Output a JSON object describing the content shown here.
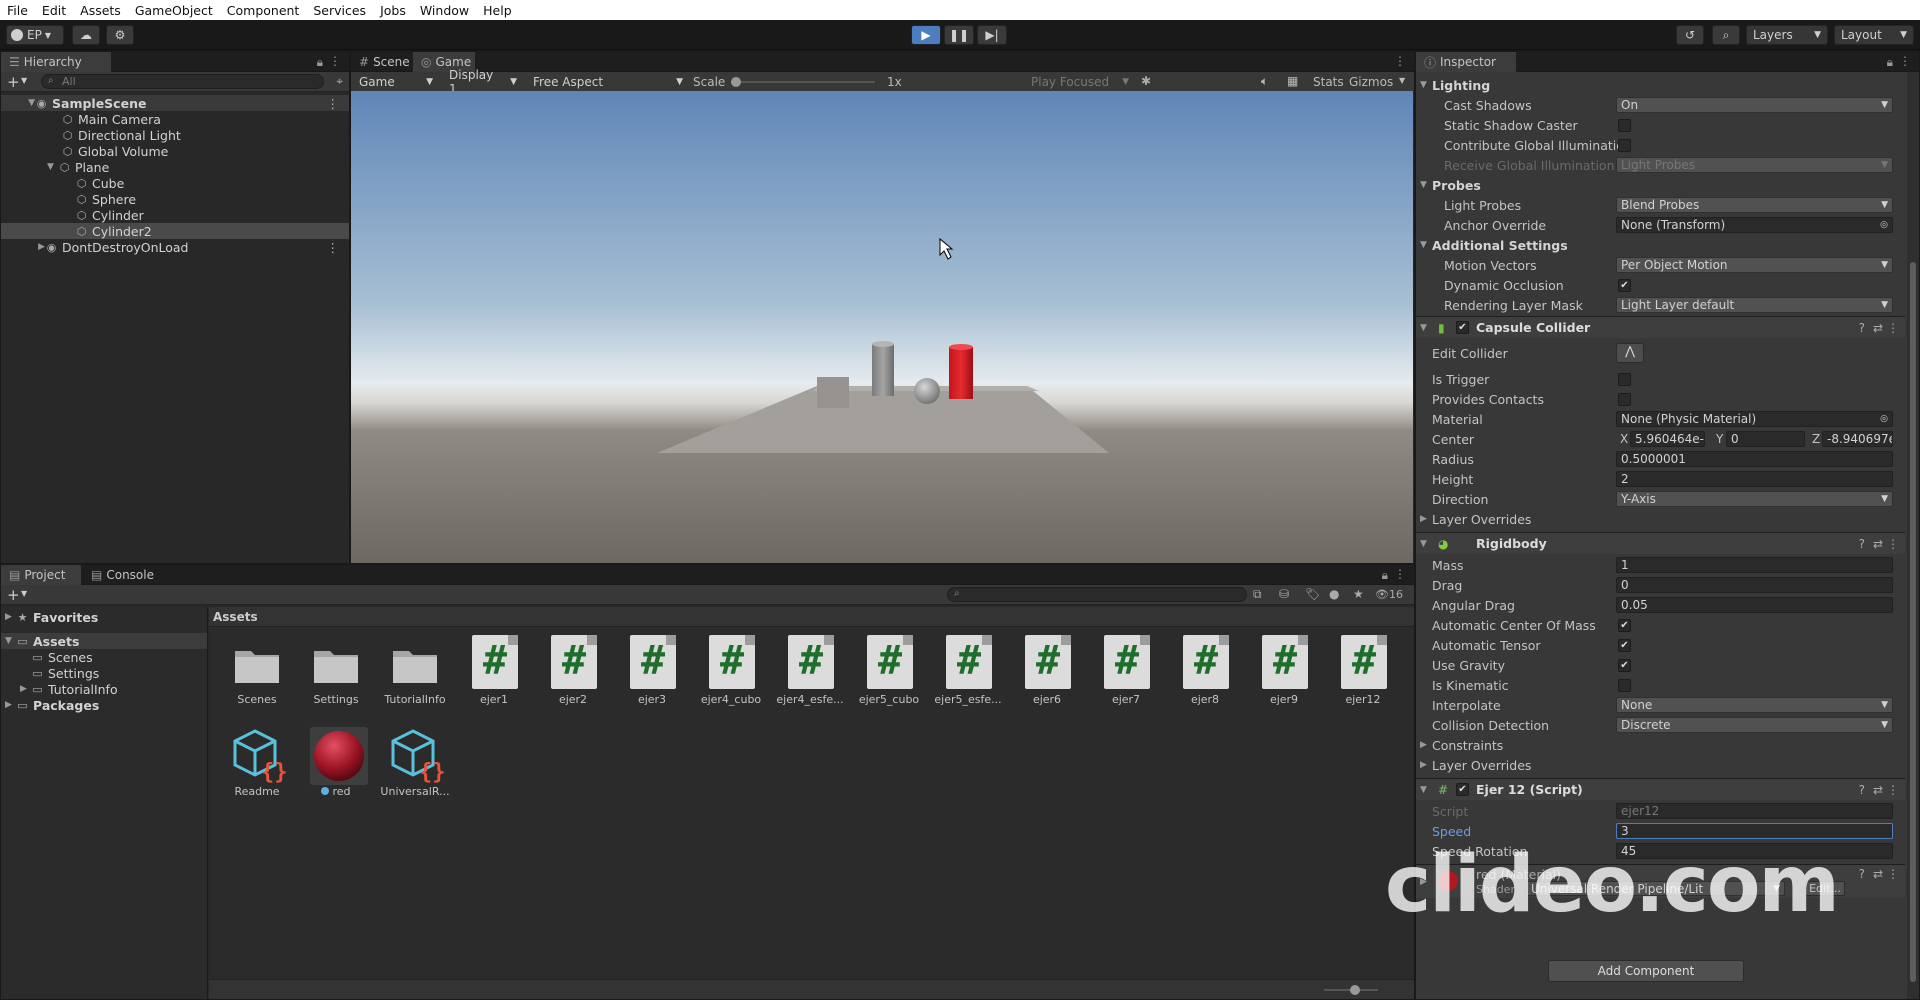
{
  "menu": [
    "File",
    "Edit",
    "Assets",
    "GameObject",
    "Component",
    "Services",
    "Jobs",
    "Window",
    "Help"
  ],
  "toolbar": {
    "account": "EP",
    "layers": "Layers",
    "layout": "Layout"
  },
  "hierarchy": {
    "tab": "Hierarchy",
    "search_placeholder": "All",
    "items": [
      {
        "label": "SampleScene"
      },
      {
        "label": "Main Camera"
      },
      {
        "label": "Directional Light"
      },
      {
        "label": "Global Volume"
      },
      {
        "label": "Plane"
      },
      {
        "label": "Cube"
      },
      {
        "label": "Sphere"
      },
      {
        "label": "Cylinder"
      },
      {
        "label": "Cylinder2"
      },
      {
        "label": "DontDestroyOnLoad"
      }
    ]
  },
  "game": {
    "tabs": [
      "Scene",
      "Game"
    ],
    "toolbar": {
      "mode": "Game",
      "display": "Display 1",
      "aspect": "Free Aspect",
      "scale_label": "Scale",
      "scale_value": "1x",
      "play_focused": "Play Focused",
      "stats": "Stats",
      "gizmos": "Gizmos"
    }
  },
  "inspector": {
    "tab": "Inspector",
    "lighting": {
      "title": "Lighting",
      "rows": [
        {
          "label": "Cast Shadows",
          "value": "On"
        },
        {
          "label": "Static Shadow Caster"
        },
        {
          "label": "Contribute Global Illumination"
        },
        {
          "label": "Receive Global Illumination",
          "value": "Light Probes"
        }
      ]
    },
    "probes": {
      "title": "Probes",
      "rows": [
        {
          "label": "Light Probes",
          "value": "Blend Probes"
        },
        {
          "label": "Anchor Override",
          "value": "None (Transform)"
        }
      ]
    },
    "additional": {
      "title": "Additional Settings",
      "rows": [
        {
          "label": "Motion Vectors",
          "value": "Per Object Motion"
        },
        {
          "label": "Dynamic Occlusion"
        },
        {
          "label": "Rendering Layer Mask",
          "value": "Light Layer default"
        }
      ]
    },
    "capsule": {
      "title": "Capsule Collider",
      "edit_collider": "Edit Collider",
      "is_trigger": "Is Trigger",
      "provides_contacts": "Provides Contacts",
      "material_label": "Material",
      "material_value": "None (Physic Material)",
      "center_label": "Center",
      "center_x": "5.960464e-(",
      "center_y": "0",
      "center_z": "-8.940697e-",
      "radius_label": "Radius",
      "radius_value": "0.5000001",
      "height_label": "Height",
      "height_value": "2",
      "direction_label": "Direction",
      "direction_value": "Y-Axis",
      "layer_overrides": "Layer Overrides"
    },
    "rigidbody": {
      "title": "Rigidbody",
      "mass_label": "Mass",
      "mass_value": "1",
      "drag_label": "Drag",
      "drag_value": "0",
      "angular_label": "Angular Drag",
      "angular_value": "0.05",
      "auto_center": "Automatic Center Of Mass",
      "auto_tensor": "Automatic Tensor",
      "use_gravity": "Use Gravity",
      "is_kinematic": "Is Kinematic",
      "interpolate_label": "Interpolate",
      "interpolate_value": "None",
      "collision_label": "Collision Detection",
      "collision_value": "Discrete",
      "constraints": "Constraints",
      "layer_overrides": "Layer Overrides"
    },
    "script": {
      "title": "Ejer 12 (Script)",
      "script_label": "Script",
      "script_value": "ejer12",
      "speed_label": "Speed",
      "speed_value": "3",
      "speed_rot_label": "Speed Rotation",
      "speed_rot_value": "45"
    },
    "material_row": {
      "title": "red (Material)",
      "shader_label": "Shader",
      "shader_value": "Universal Render Pipeline/Lit",
      "edit": "Edit..."
    },
    "add_component": "Add Component"
  },
  "project": {
    "tabs": [
      "Project",
      "Console"
    ],
    "hidden_count": "16",
    "tree": [
      {
        "label": "Favorites"
      },
      {
        "label": "Assets"
      },
      {
        "label": "Scenes"
      },
      {
        "label": "Settings"
      },
      {
        "label": "TutorialInfo"
      },
      {
        "label": "Packages"
      }
    ],
    "breadcrumb": "Assets",
    "folders": [
      "Scenes",
      "Settings",
      "TutorialInfo"
    ],
    "scripts": [
      "ejer1",
      "ejer2",
      "ejer3",
      "ejer4_cubo",
      "ejer4_esfe...",
      "ejer5_cubo",
      "ejer5_esfe...",
      "ejer6",
      "ejer7",
      "ejer8",
      "ejer9",
      "ejer12"
    ],
    "row2": [
      "Readme",
      "red",
      "UniversalR..."
    ]
  },
  "watermark": "clideo.com"
}
